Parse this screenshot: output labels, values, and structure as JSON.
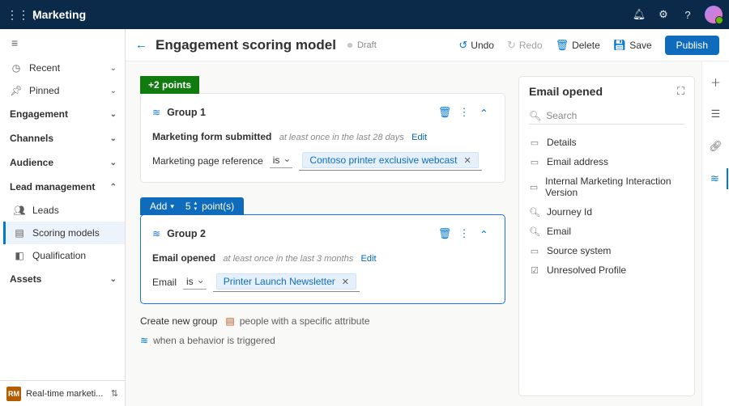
{
  "topbar": {
    "app": "Marketing"
  },
  "sidebar": {
    "recent": "Recent",
    "pinned": "Pinned",
    "sections": [
      {
        "label": "Engagement",
        "expanded": false
      },
      {
        "label": "Channels",
        "expanded": false
      },
      {
        "label": "Audience",
        "expanded": false
      },
      {
        "label": "Lead management",
        "expanded": true,
        "items": [
          {
            "label": "Leads",
            "icon": "leads"
          },
          {
            "label": "Scoring models",
            "icon": "scoring",
            "active": true
          },
          {
            "label": "Qualification",
            "icon": "qualification"
          }
        ]
      },
      {
        "label": "Assets",
        "expanded": false
      }
    ],
    "switcher": {
      "badge": "RM",
      "label": "Real-time marketi..."
    }
  },
  "header": {
    "title": "Engagement scoring model",
    "status": "Draft",
    "undo": "Undo",
    "redo": "Redo",
    "delete": "Delete",
    "save": "Save",
    "publish": "Publish"
  },
  "canvas": {
    "points_tag": "+2 points",
    "group1": {
      "title": "Group 1",
      "condition": "Marketing form submitted",
      "timeframe": "at least once in the last 28 days",
      "edit": "Edit",
      "filter_label": "Marketing page reference",
      "operator": "is",
      "token": "Contoso printer exclusive webcast"
    },
    "add_bar": {
      "add": "Add",
      "value": "5",
      "unit": "point(s)"
    },
    "group2": {
      "title": "Group 2",
      "condition": "Email opened",
      "timeframe": "at least once in the last 3 months",
      "edit": "Edit",
      "filter_label": "Email",
      "operator": "is",
      "token": "Printer Launch Newsletter"
    },
    "create": {
      "lead": "Create new group",
      "opt1": "people with a specific attribute",
      "opt2": "when a behavior is triggered"
    }
  },
  "rightpane": {
    "title": "Email opened",
    "search_placeholder": "Search",
    "items": [
      "Details",
      "Email address",
      "Internal Marketing Interaction Version",
      "Journey Id",
      "Email",
      "Source system",
      "Unresolved Profile"
    ]
  }
}
